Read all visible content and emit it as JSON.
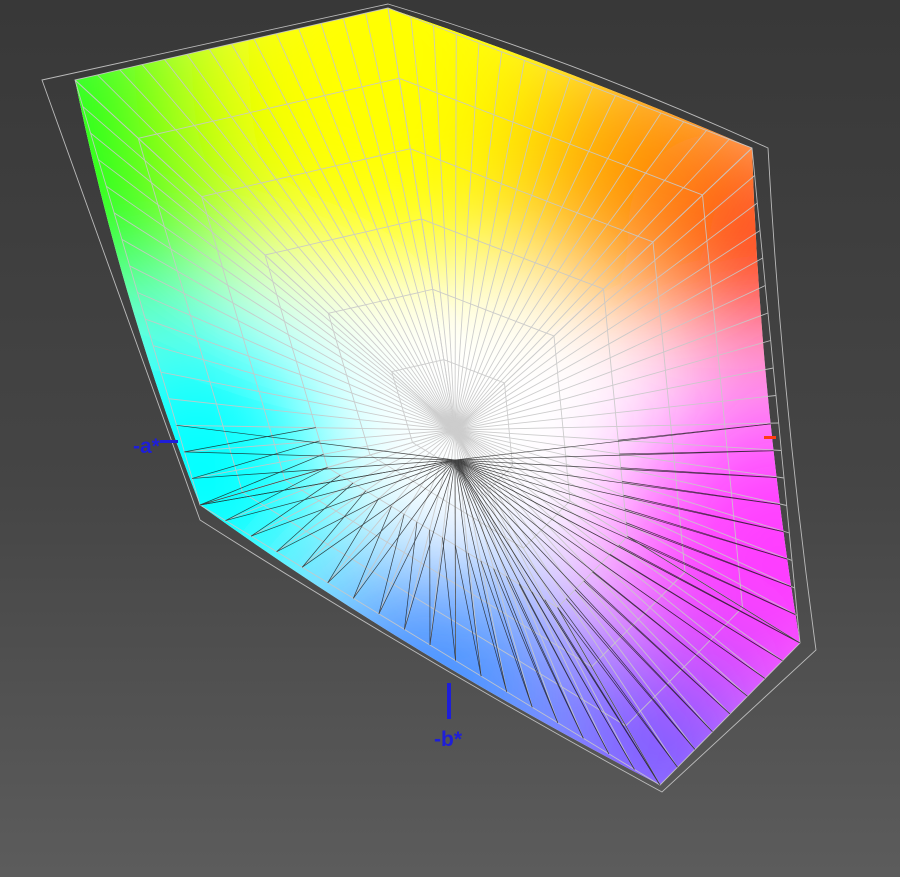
{
  "view": {
    "background_color": "#404040"
  },
  "axes": {
    "neg_a_label": "-a*",
    "neg_b_label": "-b*",
    "label_color": "#1e1ed9"
  },
  "gamut": {
    "colors": {
      "green": "#22ff1e",
      "yellow": "#ffff00",
      "orange": "#ff9a00",
      "red": "#ff3c12",
      "magenta": "#ff3cff",
      "violet": "#7c56ff",
      "blue": "#4a92ff",
      "cyan": "#00ffff",
      "white": "#ffffff"
    },
    "wireframe_outer_color": "#c8c8c8",
    "wireframe_inner_color": "#1a1a1a"
  }
}
